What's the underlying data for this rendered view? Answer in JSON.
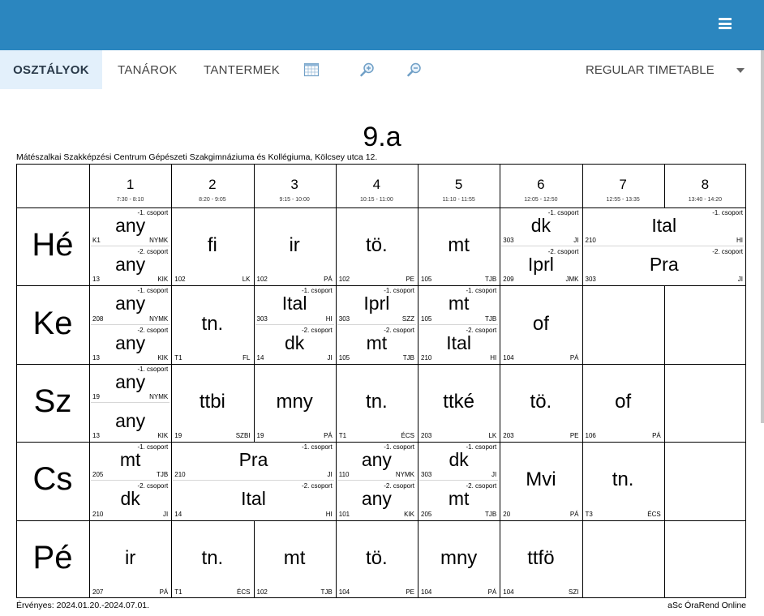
{
  "nav": {
    "tabs": [
      "OSZTÁLYOK",
      "TANÁROK",
      "TANTERMEK"
    ],
    "timetable": "REGULAR TIMETABLE"
  },
  "class_name": "9.a",
  "school": "Mátészalkai Szakképzési Centrum Gépészeti Szakgimnáziuma és Kollégiuma, Kölcsey utca 12.",
  "periods": [
    {
      "num": "1",
      "time": "7:30 - 8:10"
    },
    {
      "num": "2",
      "time": "8:20 - 9:05"
    },
    {
      "num": "3",
      "time": "9:15 - 10:00"
    },
    {
      "num": "4",
      "time": "10:15 - 11:00"
    },
    {
      "num": "5",
      "time": "11:10 - 11:55"
    },
    {
      "num": "6",
      "time": "12:05 - 12:50"
    },
    {
      "num": "7",
      "time": "12:55 - 13:35"
    },
    {
      "num": "8",
      "time": "13:40 - 14:20"
    }
  ],
  "days": [
    "Hé",
    "Ke",
    "Sz",
    "Cs",
    "Pé"
  ],
  "footer": {
    "valid": "Érvényes: 2024.01.20.-2024.07.01.",
    "brand": "aSc ÓraRend Online"
  },
  "lessons": [
    {
      "day": 0,
      "p": 0,
      "span": 1,
      "half": "top",
      "subj": "any",
      "grp": "-1. csoport",
      "room": "K1",
      "tch": "NYMK"
    },
    {
      "day": 0,
      "p": 0,
      "span": 1,
      "half": "bottom",
      "subj": "any",
      "grp": "-2. csoport",
      "room": "13",
      "tch": "KIK"
    },
    {
      "day": 0,
      "p": 1,
      "span": 1,
      "half": "full",
      "subj": "fi",
      "room": "102",
      "tch": "LK"
    },
    {
      "day": 0,
      "p": 2,
      "span": 1,
      "half": "full",
      "subj": "ir",
      "room": "102",
      "tch": "PÁ"
    },
    {
      "day": 0,
      "p": 3,
      "span": 1,
      "half": "full",
      "subj": "tö.",
      "room": "102",
      "tch": "PE"
    },
    {
      "day": 0,
      "p": 4,
      "span": 1,
      "half": "full",
      "subj": "mt",
      "room": "105",
      "tch": "TJB"
    },
    {
      "day": 0,
      "p": 5,
      "span": 1,
      "half": "top",
      "subj": "dk",
      "grp": "-1. csoport",
      "room": "303",
      "tch": "JI"
    },
    {
      "day": 0,
      "p": 5,
      "span": 1,
      "half": "bottom",
      "subj": "Iprl",
      "grp": "-2. csoport",
      "room": "209",
      "tch": "JMK"
    },
    {
      "day": 0,
      "p": 6,
      "span": 2,
      "half": "top",
      "subj": "Ital",
      "grp": "-1. csoport",
      "room": "210",
      "tch": "HI"
    },
    {
      "day": 0,
      "p": 6,
      "span": 2,
      "half": "bottom",
      "subj": "Pra",
      "grp": "-2. csoport",
      "room": "303",
      "tch": "JI"
    },
    {
      "day": 1,
      "p": 0,
      "span": 1,
      "half": "top",
      "subj": "any",
      "grp": "-1. csoport",
      "room": "208",
      "tch": "NYMK"
    },
    {
      "day": 1,
      "p": 0,
      "span": 1,
      "half": "bottom",
      "subj": "any",
      "grp": "-2. csoport",
      "room": "13",
      "tch": "KIK"
    },
    {
      "day": 1,
      "p": 1,
      "span": 1,
      "half": "full",
      "subj": "tn.",
      "room": "T1",
      "tch": "FL"
    },
    {
      "day": 1,
      "p": 2,
      "span": 1,
      "half": "top",
      "subj": "Ital",
      "grp": "-1. csoport",
      "room": "303",
      "tch": "HI"
    },
    {
      "day": 1,
      "p": 2,
      "span": 1,
      "half": "bottom",
      "subj": "dk",
      "grp": "-2. csoport",
      "room": "14",
      "tch": "JI"
    },
    {
      "day": 1,
      "p": 3,
      "span": 1,
      "half": "top",
      "subj": "Iprl",
      "grp": "-1. csoport",
      "room": "303",
      "tch": "SZZ"
    },
    {
      "day": 1,
      "p": 3,
      "span": 1,
      "half": "bottom",
      "subj": "mt",
      "grp": "-2. csoport",
      "room": "105",
      "tch": "TJB"
    },
    {
      "day": 1,
      "p": 4,
      "span": 1,
      "half": "top",
      "subj": "mt",
      "grp": "-1. csoport",
      "room": "105",
      "tch": "TJB"
    },
    {
      "day": 1,
      "p": 4,
      "span": 1,
      "half": "bottom",
      "subj": "Ital",
      "grp": "-2. csoport",
      "room": "210",
      "tch": "HI"
    },
    {
      "day": 1,
      "p": 5,
      "span": 1,
      "half": "full",
      "subj": "of",
      "room": "104",
      "tch": "PÁ"
    },
    {
      "day": 2,
      "p": 0,
      "span": 1,
      "half": "top",
      "subj": "any",
      "grp": "-1. csoport",
      "room": "19",
      "tch": "NYMK"
    },
    {
      "day": 2,
      "p": 0,
      "span": 1,
      "half": "bottom",
      "subj": "any",
      "grp": "",
      "room": "13",
      "tch": "KIK"
    },
    {
      "day": 2,
      "p": 1,
      "span": 1,
      "half": "full",
      "subj": "ttbi",
      "room": "19",
      "tch": "SZBI"
    },
    {
      "day": 2,
      "p": 2,
      "span": 1,
      "half": "full",
      "subj": "mny",
      "room": "19",
      "tch": "PÁ"
    },
    {
      "day": 2,
      "p": 3,
      "span": 1,
      "half": "full",
      "subj": "tn.",
      "room": "T1",
      "tch": "ÉCS"
    },
    {
      "day": 2,
      "p": 4,
      "span": 1,
      "half": "full",
      "subj": "ttké",
      "room": "203",
      "tch": "LK"
    },
    {
      "day": 2,
      "p": 5,
      "span": 1,
      "half": "full",
      "subj": "tö.",
      "room": "203",
      "tch": "PE"
    },
    {
      "day": 2,
      "p": 6,
      "span": 1,
      "half": "full",
      "subj": "of",
      "room": "106",
      "tch": "PÁ"
    },
    {
      "day": 3,
      "p": 0,
      "span": 1,
      "half": "top",
      "subj": "mt",
      "grp": "-1. csoport",
      "room": "205",
      "tch": "TJB"
    },
    {
      "day": 3,
      "p": 0,
      "span": 1,
      "half": "bottom",
      "subj": "dk",
      "grp": "-2. csoport",
      "room": "210",
      "tch": "JI"
    },
    {
      "day": 3,
      "p": 1,
      "span": 2,
      "half": "top",
      "subj": "Pra",
      "grp": "-1. csoport",
      "room": "210",
      "tch": "JI"
    },
    {
      "day": 3,
      "p": 1,
      "span": 2,
      "half": "bottom",
      "subj": "Ital",
      "grp": "-2. csoport",
      "room": "14",
      "tch": "HI"
    },
    {
      "day": 3,
      "p": 3,
      "span": 1,
      "half": "top",
      "subj": "any",
      "grp": "-1. csoport",
      "room": "110",
      "tch": "NYMK"
    },
    {
      "day": 3,
      "p": 3,
      "span": 1,
      "half": "bottom",
      "subj": "any",
      "grp": "-2. csoport",
      "room": "101",
      "tch": "KIK"
    },
    {
      "day": 3,
      "p": 4,
      "span": 1,
      "half": "top",
      "subj": "dk",
      "grp": "-1. csoport",
      "room": "303",
      "tch": "JI"
    },
    {
      "day": 3,
      "p": 4,
      "span": 1,
      "half": "bottom",
      "subj": "mt",
      "grp": "-2. csoport",
      "room": "205",
      "tch": "TJB"
    },
    {
      "day": 3,
      "p": 5,
      "span": 1,
      "half": "full",
      "subj": "Mvi",
      "room": "20",
      "tch": "PÁ"
    },
    {
      "day": 3,
      "p": 6,
      "span": 1,
      "half": "full",
      "subj": "tn.",
      "room": "T3",
      "tch": "ÉCS"
    },
    {
      "day": 4,
      "p": 0,
      "span": 1,
      "half": "full",
      "subj": "ir",
      "room": "207",
      "tch": "PÁ"
    },
    {
      "day": 4,
      "p": 1,
      "span": 1,
      "half": "full",
      "subj": "tn.",
      "room": "T1",
      "tch": "ÉCS"
    },
    {
      "day": 4,
      "p": 2,
      "span": 1,
      "half": "full",
      "subj": "mt",
      "room": "102",
      "tch": "TJB"
    },
    {
      "day": 4,
      "p": 3,
      "span": 1,
      "half": "full",
      "subj": "tö.",
      "room": "104",
      "tch": "PE"
    },
    {
      "day": 4,
      "p": 4,
      "span": 1,
      "half": "full",
      "subj": "mny",
      "room": "104",
      "tch": "PÁ"
    },
    {
      "day": 4,
      "p": 5,
      "span": 1,
      "half": "full",
      "subj": "ttfö",
      "room": "104",
      "tch": "SZI"
    }
  ]
}
